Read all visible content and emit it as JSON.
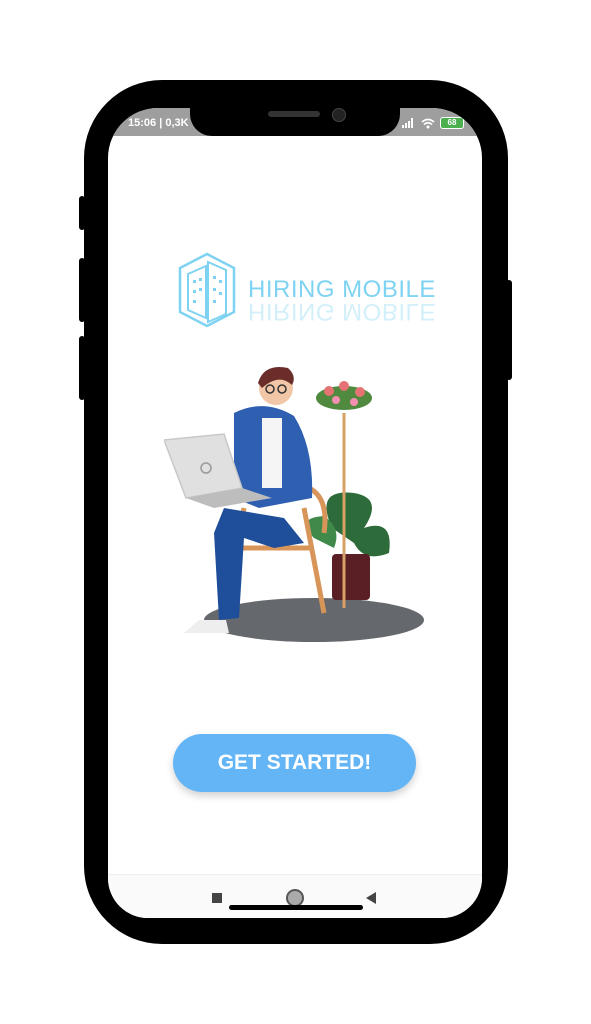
{
  "status_bar": {
    "time": "15:06 | 0,3K",
    "battery": "68"
  },
  "logo": {
    "text": "HIRING MOBILE"
  },
  "cta": {
    "label": "GET STARTED!"
  },
  "colors": {
    "accent": "#64b5f6",
    "logo": "#7fd3f2",
    "status_bar": "#9e9e9e"
  }
}
